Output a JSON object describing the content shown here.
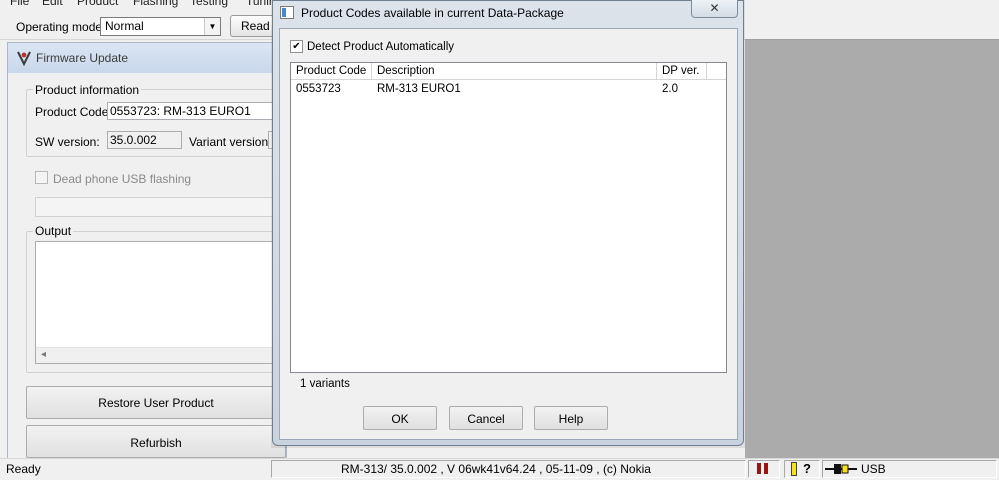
{
  "menu": {
    "items": [
      "File",
      "Edit",
      "Product",
      "Flashing",
      "Testing",
      "Tuning"
    ]
  },
  "toolbar": {
    "operating_mode_label": "Operating mode:",
    "operating_mode_value": "Normal",
    "read_button": "Read"
  },
  "firmware_window": {
    "title": "Firmware Update",
    "product_info_group": "Product information",
    "product_code_label": "Product Code:",
    "product_code_value": "0553723: RM-313 EURO1",
    "sw_version_label": "SW version:",
    "sw_version_value": "35.0.002",
    "variant_version_label": "Variant version:",
    "dead_phone_label": "Dead phone USB flashing",
    "output_group": "Output",
    "restore_button": "Restore User Product",
    "refurbish_button": "Refurbish"
  },
  "dialog": {
    "title": "Product Codes available in current Data-Package",
    "close_glyph": "✕",
    "detect_label": "Detect Product Automatically",
    "detect_checked": true,
    "columns": [
      "Product Code",
      "Description",
      "DP ver."
    ],
    "rows": [
      {
        "code": "0553723",
        "description": "RM-313 EURO1",
        "dp_ver": "2.0"
      }
    ],
    "variant_count": "1 variants",
    "ok_button": "OK",
    "cancel_button": "Cancel",
    "help_button": "Help"
  },
  "statusbar": {
    "ready": "Ready",
    "info": "RM-313/ 35.0.002 , V 06wk41v64.24 , 05-11-09 , (c) Nokia",
    "help_glyph": "?",
    "connection": "USB"
  },
  "colors": {
    "workspace": "#ababab",
    "status_red": "#9b1414",
    "status_yellow": "#f5e21a"
  }
}
